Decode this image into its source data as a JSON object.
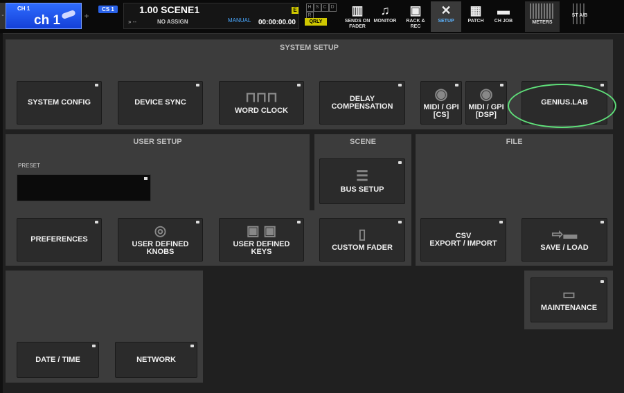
{
  "header": {
    "ch_small": "CH 1",
    "ch_name": "ch 1",
    "side_minus": "-",
    "side_plus": "+",
    "cs_badge": "CS 1",
    "scene_title": "1.00 SCENE1",
    "scene_arrow": "»  --",
    "scene_assign": "NO ASSIGN",
    "scene_mode": "MANUAL",
    "scene_time": "00:00:00.00",
    "scene_e": "E",
    "meter_letters": [
      "H",
      "S",
      "C",
      "D",
      "R"
    ],
    "qrly": "QRLY",
    "buttons": {
      "sends_on_fader": "SENDS ON FADER",
      "monitor": "MONITOR",
      "rack_rec": "RACK & REC",
      "setup": "SETUP",
      "patch": "PATCH",
      "ch_job": "CH JOB",
      "meters": "METERS",
      "st_ab": "ST A/B"
    }
  },
  "system_setup": {
    "title": "SYSTEM SETUP",
    "system_config": "SYSTEM CONFIG",
    "device_sync": "DEVICE SYNC",
    "word_clock": "WORD CLOCK",
    "delay_comp_1": "DELAY",
    "delay_comp_2": "COMPENSATION",
    "midi_cs_1": "MIDI / GPI",
    "midi_cs_2": "[CS]",
    "midi_dsp_1": "MIDI / GPI",
    "midi_dsp_2": "[DSP]",
    "genius_lab": "GENIUS.LAB"
  },
  "user_setup": {
    "title": "USER SETUP",
    "preset_label": "PRESET",
    "preferences": "PREFERENCES",
    "udk_1": "USER DEFINED",
    "udk_2": "KNOBS",
    "udkeys_1": "USER DEFINED",
    "udkeys_2": "KEYS",
    "custom_fader": "CUSTOM FADER"
  },
  "scene": {
    "title": "SCENE",
    "bus_setup": "BUS SETUP"
  },
  "file": {
    "title": "FILE",
    "csv_1": "CSV",
    "csv_2": "EXPORT / IMPORT",
    "save_load": "SAVE / LOAD"
  },
  "misc": {
    "date_time": "DATE / TIME",
    "network": "NETWORK",
    "maintenance": "MAINTENANCE"
  },
  "colors": {
    "accent_blue": "#2f6cff",
    "setup_active": "#5cb4ff",
    "highlight_circle": "#5fe07a",
    "panel_bg": "#3c3c3c",
    "button_bg": "#2b2b2b"
  }
}
